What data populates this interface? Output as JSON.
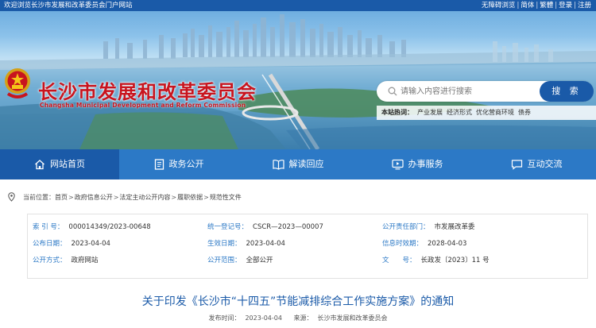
{
  "topbar": {
    "welcome": "欢迎浏览长沙市发展和改革委员会门户网站",
    "links": [
      "无障碍浏览",
      "简体",
      "繁體",
      "登录",
      "注册"
    ]
  },
  "header": {
    "title": "长沙市发展和改革委员会",
    "subtitle": "Changsha Municipal Development and Reform Commission"
  },
  "search": {
    "placeholder": "请输入内容进行搜索",
    "button": "搜 索"
  },
  "hotwords": {
    "label": "本站热词：",
    "items": [
      "产业发展",
      "经济形式",
      "优化营商环境",
      "债券"
    ]
  },
  "nav": {
    "items": [
      {
        "label": "网站首页",
        "icon": "home-icon",
        "active": true
      },
      {
        "label": "政务公开",
        "icon": "document-icon",
        "active": false
      },
      {
        "label": "解读回应",
        "icon": "book-icon",
        "active": false
      },
      {
        "label": "办事服务",
        "icon": "monitor-icon",
        "active": false
      },
      {
        "label": "互动交流",
        "icon": "chat-icon",
        "active": false
      }
    ]
  },
  "breadcrumb": {
    "label": "当前位置：",
    "items": [
      "首页",
      "政府信息公开",
      "法定主动公开内容",
      "履职依据",
      "规范性文件"
    ]
  },
  "meta": {
    "index_no": {
      "key": "索 引 号：",
      "value": "000014349/2023-00648"
    },
    "unified_no": {
      "key": "统一登记号：",
      "value": "CSCR—2023—00007"
    },
    "dept": {
      "key": "公开责任部门：",
      "value": "市发展改革委"
    },
    "pub_date": {
      "key": "公布日期：",
      "value": "2023-04-04"
    },
    "effective_date": {
      "key": "生效日期：",
      "value": "2023-04-04"
    },
    "expire_date": {
      "key": "信息时效期：",
      "value": "2028-04-03"
    },
    "method": {
      "key": "公开方式：",
      "value": "政府网站"
    },
    "scope": {
      "key": "公开范围：",
      "value": "全部公开"
    },
    "doc_no": {
      "key": "文　　号：",
      "value": "长政发〔2023〕11 号"
    }
  },
  "article": {
    "title": "关于印发《长沙市“十四五”节能减排综合工作实施方案》的通知",
    "publish_label": "发布时间：",
    "publish_date": "2023-04-04",
    "source_label": "来源：",
    "source": "长沙市发展和改革委员会"
  },
  "colors": {
    "primary": "#1a5aa8",
    "nav": "#2c79c6",
    "title_red": "#c8141e"
  }
}
